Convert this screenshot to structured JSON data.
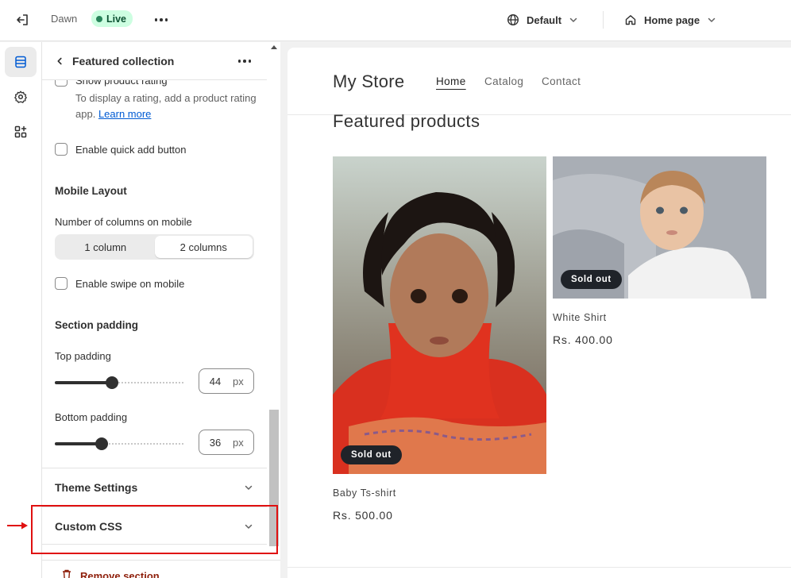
{
  "topbar": {
    "theme_name": "Dawn",
    "live_label": "Live",
    "template_select": "Default",
    "page_select": "Home page"
  },
  "rail": {
    "items": [
      "sections-icon",
      "settings-icon",
      "apps-icon"
    ]
  },
  "panel": {
    "title": "Featured collection",
    "show_rating_label": "Show product rating",
    "rating_help": "To display a rating, add a product rating app.",
    "rating_help_link": "Learn more",
    "quick_add_label": "Enable quick add button",
    "mobile_layout_heading": "Mobile Layout",
    "columns_label": "Number of columns on mobile",
    "column_options": [
      "1 column",
      "2 columns"
    ],
    "column_selected": "2 columns",
    "swipe_label": "Enable swipe on mobile",
    "padding_heading": "Section padding",
    "top_padding_label": "Top padding",
    "top_padding_value": "44",
    "top_padding_fraction": 0.44,
    "bottom_padding_label": "Bottom padding",
    "bottom_padding_value": "36",
    "bottom_padding_fraction": 0.36,
    "unit": "px",
    "theme_settings_label": "Theme Settings",
    "custom_css_label": "Custom CSS",
    "remove_label": "Remove section"
  },
  "preview": {
    "store_name": "My Store",
    "nav": [
      "Home",
      "Catalog",
      "Contact"
    ],
    "nav_active": "Home",
    "section_title": "Featured products",
    "products": [
      {
        "name": "Baby Ts-shirt",
        "price": "Rs. 500.00",
        "badge": "Sold out"
      },
      {
        "name": "White Shirt",
        "price": "Rs. 400.00",
        "badge": "Sold out"
      }
    ]
  },
  "colors": {
    "live_badge_bg": "#cdfee1",
    "live_badge_text": "#0c5132",
    "link": "#005bd3",
    "highlight": "#e01010",
    "remove_text": "#8e1f0b"
  }
}
